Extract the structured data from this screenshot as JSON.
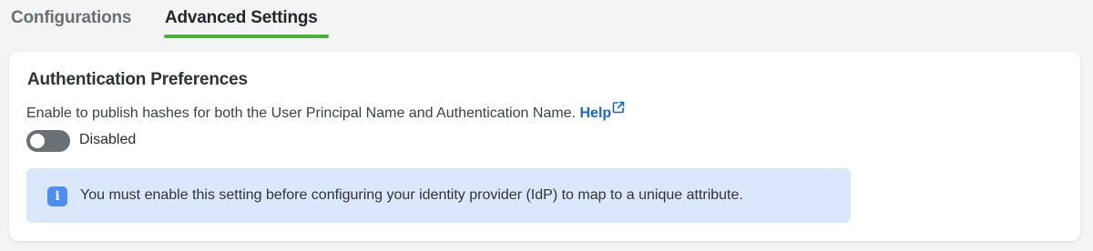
{
  "tabs": [
    {
      "label": "Configurations",
      "active": false
    },
    {
      "label": "Advanced Settings",
      "active": true
    }
  ],
  "section": {
    "title": "Authentication Preferences",
    "description": "Enable to publish hashes for both the User Principal Name and Authentication Name.",
    "help_label": "Help",
    "help_icon": "external-link-icon",
    "toggle": {
      "state": "off",
      "label": "Disabled"
    },
    "info_banner": {
      "icon": "info-icon",
      "text": "You must enable this setting before configuring your identity provider (IdP) to map to a unique attribute."
    }
  },
  "colors": {
    "accent_green": "#4caf3a",
    "link_blue": "#1868c4",
    "toggle_off": "#6b7075",
    "banner_bg": "#dbe8fb",
    "info_icon_bg": "#4f8ef0"
  }
}
